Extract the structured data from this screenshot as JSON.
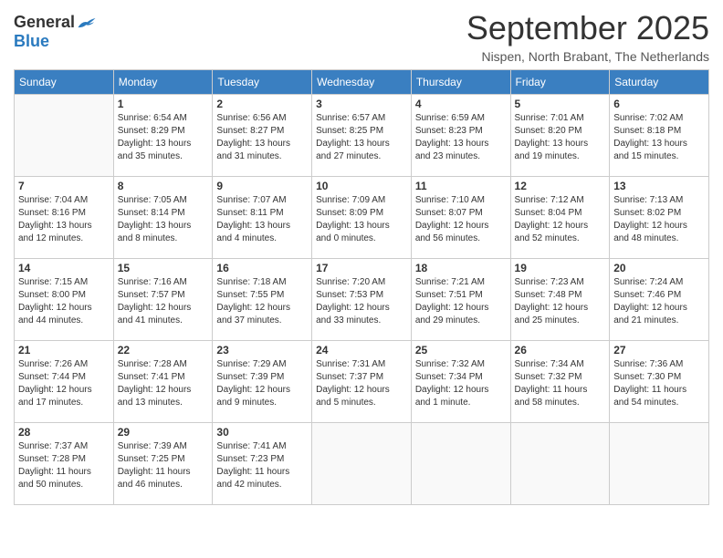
{
  "header": {
    "logo_general": "General",
    "logo_blue": "Blue",
    "month_title": "September 2025",
    "subtitle": "Nispen, North Brabant, The Netherlands"
  },
  "weekdays": [
    "Sunday",
    "Monday",
    "Tuesday",
    "Wednesday",
    "Thursday",
    "Friday",
    "Saturday"
  ],
  "weeks": [
    [
      {
        "day": "",
        "info": ""
      },
      {
        "day": "1",
        "info": "Sunrise: 6:54 AM\nSunset: 8:29 PM\nDaylight: 13 hours\nand 35 minutes."
      },
      {
        "day": "2",
        "info": "Sunrise: 6:56 AM\nSunset: 8:27 PM\nDaylight: 13 hours\nand 31 minutes."
      },
      {
        "day": "3",
        "info": "Sunrise: 6:57 AM\nSunset: 8:25 PM\nDaylight: 13 hours\nand 27 minutes."
      },
      {
        "day": "4",
        "info": "Sunrise: 6:59 AM\nSunset: 8:23 PM\nDaylight: 13 hours\nand 23 minutes."
      },
      {
        "day": "5",
        "info": "Sunrise: 7:01 AM\nSunset: 8:20 PM\nDaylight: 13 hours\nand 19 minutes."
      },
      {
        "day": "6",
        "info": "Sunrise: 7:02 AM\nSunset: 8:18 PM\nDaylight: 13 hours\nand 15 minutes."
      }
    ],
    [
      {
        "day": "7",
        "info": "Sunrise: 7:04 AM\nSunset: 8:16 PM\nDaylight: 13 hours\nand 12 minutes."
      },
      {
        "day": "8",
        "info": "Sunrise: 7:05 AM\nSunset: 8:14 PM\nDaylight: 13 hours\nand 8 minutes."
      },
      {
        "day": "9",
        "info": "Sunrise: 7:07 AM\nSunset: 8:11 PM\nDaylight: 13 hours\nand 4 minutes."
      },
      {
        "day": "10",
        "info": "Sunrise: 7:09 AM\nSunset: 8:09 PM\nDaylight: 13 hours\nand 0 minutes."
      },
      {
        "day": "11",
        "info": "Sunrise: 7:10 AM\nSunset: 8:07 PM\nDaylight: 12 hours\nand 56 minutes."
      },
      {
        "day": "12",
        "info": "Sunrise: 7:12 AM\nSunset: 8:04 PM\nDaylight: 12 hours\nand 52 minutes."
      },
      {
        "day": "13",
        "info": "Sunrise: 7:13 AM\nSunset: 8:02 PM\nDaylight: 12 hours\nand 48 minutes."
      }
    ],
    [
      {
        "day": "14",
        "info": "Sunrise: 7:15 AM\nSunset: 8:00 PM\nDaylight: 12 hours\nand 44 minutes."
      },
      {
        "day": "15",
        "info": "Sunrise: 7:16 AM\nSunset: 7:57 PM\nDaylight: 12 hours\nand 41 minutes."
      },
      {
        "day": "16",
        "info": "Sunrise: 7:18 AM\nSunset: 7:55 PM\nDaylight: 12 hours\nand 37 minutes."
      },
      {
        "day": "17",
        "info": "Sunrise: 7:20 AM\nSunset: 7:53 PM\nDaylight: 12 hours\nand 33 minutes."
      },
      {
        "day": "18",
        "info": "Sunrise: 7:21 AM\nSunset: 7:51 PM\nDaylight: 12 hours\nand 29 minutes."
      },
      {
        "day": "19",
        "info": "Sunrise: 7:23 AM\nSunset: 7:48 PM\nDaylight: 12 hours\nand 25 minutes."
      },
      {
        "day": "20",
        "info": "Sunrise: 7:24 AM\nSunset: 7:46 PM\nDaylight: 12 hours\nand 21 minutes."
      }
    ],
    [
      {
        "day": "21",
        "info": "Sunrise: 7:26 AM\nSunset: 7:44 PM\nDaylight: 12 hours\nand 17 minutes."
      },
      {
        "day": "22",
        "info": "Sunrise: 7:28 AM\nSunset: 7:41 PM\nDaylight: 12 hours\nand 13 minutes."
      },
      {
        "day": "23",
        "info": "Sunrise: 7:29 AM\nSunset: 7:39 PM\nDaylight: 12 hours\nand 9 minutes."
      },
      {
        "day": "24",
        "info": "Sunrise: 7:31 AM\nSunset: 7:37 PM\nDaylight: 12 hours\nand 5 minutes."
      },
      {
        "day": "25",
        "info": "Sunrise: 7:32 AM\nSunset: 7:34 PM\nDaylight: 12 hours\nand 1 minute."
      },
      {
        "day": "26",
        "info": "Sunrise: 7:34 AM\nSunset: 7:32 PM\nDaylight: 11 hours\nand 58 minutes."
      },
      {
        "day": "27",
        "info": "Sunrise: 7:36 AM\nSunset: 7:30 PM\nDaylight: 11 hours\nand 54 minutes."
      }
    ],
    [
      {
        "day": "28",
        "info": "Sunrise: 7:37 AM\nSunset: 7:28 PM\nDaylight: 11 hours\nand 50 minutes."
      },
      {
        "day": "29",
        "info": "Sunrise: 7:39 AM\nSunset: 7:25 PM\nDaylight: 11 hours\nand 46 minutes."
      },
      {
        "day": "30",
        "info": "Sunrise: 7:41 AM\nSunset: 7:23 PM\nDaylight: 11 hours\nand 42 minutes."
      },
      {
        "day": "",
        "info": ""
      },
      {
        "day": "",
        "info": ""
      },
      {
        "day": "",
        "info": ""
      },
      {
        "day": "",
        "info": ""
      }
    ]
  ]
}
